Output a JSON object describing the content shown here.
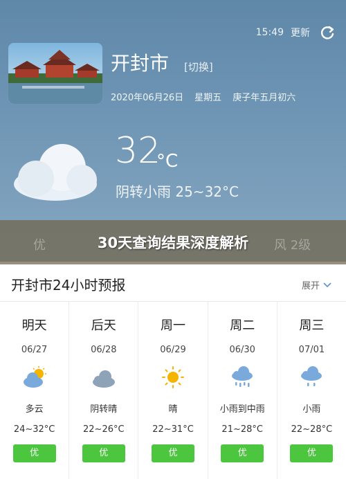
{
  "header": {
    "time": "15:49",
    "refresh_label": "更新",
    "city": "开封市",
    "switch_label": "[切换]",
    "date": "2020年06月26日",
    "weekday": "星期五",
    "lunar": "庚子年五月初六",
    "temperature": "32",
    "unit": "°C",
    "condition": "阴转小雨 25~32°C"
  },
  "banner": {
    "title": "30天查询结果深度解析",
    "faded_left": "优",
    "faded_right": "风 2级"
  },
  "forecast": {
    "title": "开封市24小时预报",
    "expand_label": "展开",
    "days": [
      {
        "name": "明天",
        "date": "06/27",
        "icon": "sun-cloud-icon",
        "condition": "多云",
        "range": "24~32°C",
        "aqi": "优"
      },
      {
        "name": "后天",
        "date": "06/28",
        "icon": "cloud-icon",
        "condition": "阴转晴",
        "range": "22~26°C",
        "aqi": "优"
      },
      {
        "name": "周一",
        "date": "06/29",
        "icon": "sun-icon",
        "condition": "晴",
        "range": "22~31°C",
        "aqi": "优"
      },
      {
        "name": "周二",
        "date": "06/30",
        "icon": "heavy-rain-icon",
        "condition": "小雨到中雨",
        "range": "21~28°C",
        "aqi": "优"
      },
      {
        "name": "周三",
        "date": "07/01",
        "icon": "light-rain-icon",
        "condition": "小雨",
        "range": "22~28°C",
        "aqi": "优"
      }
    ]
  },
  "colors": {
    "header_top": "#5f87a8",
    "aqi_good": "#4cc53f",
    "sun": "#f5b400",
    "cloud": "#7aa9db"
  }
}
